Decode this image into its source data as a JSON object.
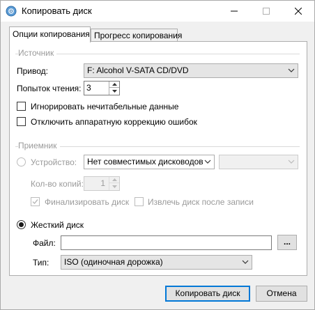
{
  "window": {
    "title": "Копировать диск",
    "icon": "disc-copy-icon"
  },
  "tabs": [
    {
      "label": "Опции копирования",
      "active": true
    },
    {
      "label": "Прогресс копирования",
      "active": false
    }
  ],
  "source": {
    "group_title": "Источник",
    "drive_label": "Привод:",
    "drive_value": "F: Alcohol V-SATA CD/DVD",
    "read_attempts_label": "Попыток чтения:",
    "read_attempts_value": "3",
    "ignore_unreadable_label": "Игнорировать нечитабельные данные",
    "ignore_unreadable_checked": false,
    "disable_ecc_label": "Отключить аппаратную коррекцию ошибок",
    "disable_ecc_checked": false
  },
  "target": {
    "group_title": "Приемник",
    "device_label": "Устройство:",
    "device_value": "Нет совместимых дисководов",
    "speed_value": "",
    "copies_label": "Кол-во копий:",
    "copies_value": "1",
    "finalize_label": "Финализировать диск",
    "finalize_checked": true,
    "eject_label": "Извлечь диск после записи",
    "eject_checked": false,
    "hdd_label": "Жесткий диск",
    "hdd_selected": true,
    "file_label": "Файл:",
    "file_value": "",
    "browse_label": "...",
    "type_label": "Тип:",
    "type_value": "ISO (одиночная дорожка)"
  },
  "buttons": {
    "copy_label": "Копировать диск",
    "cancel_label": "Отмена"
  },
  "colors": {
    "accent": "#0078d7",
    "disabled_text": "#9a9a9a",
    "window_bg": "#f0f0f0"
  }
}
